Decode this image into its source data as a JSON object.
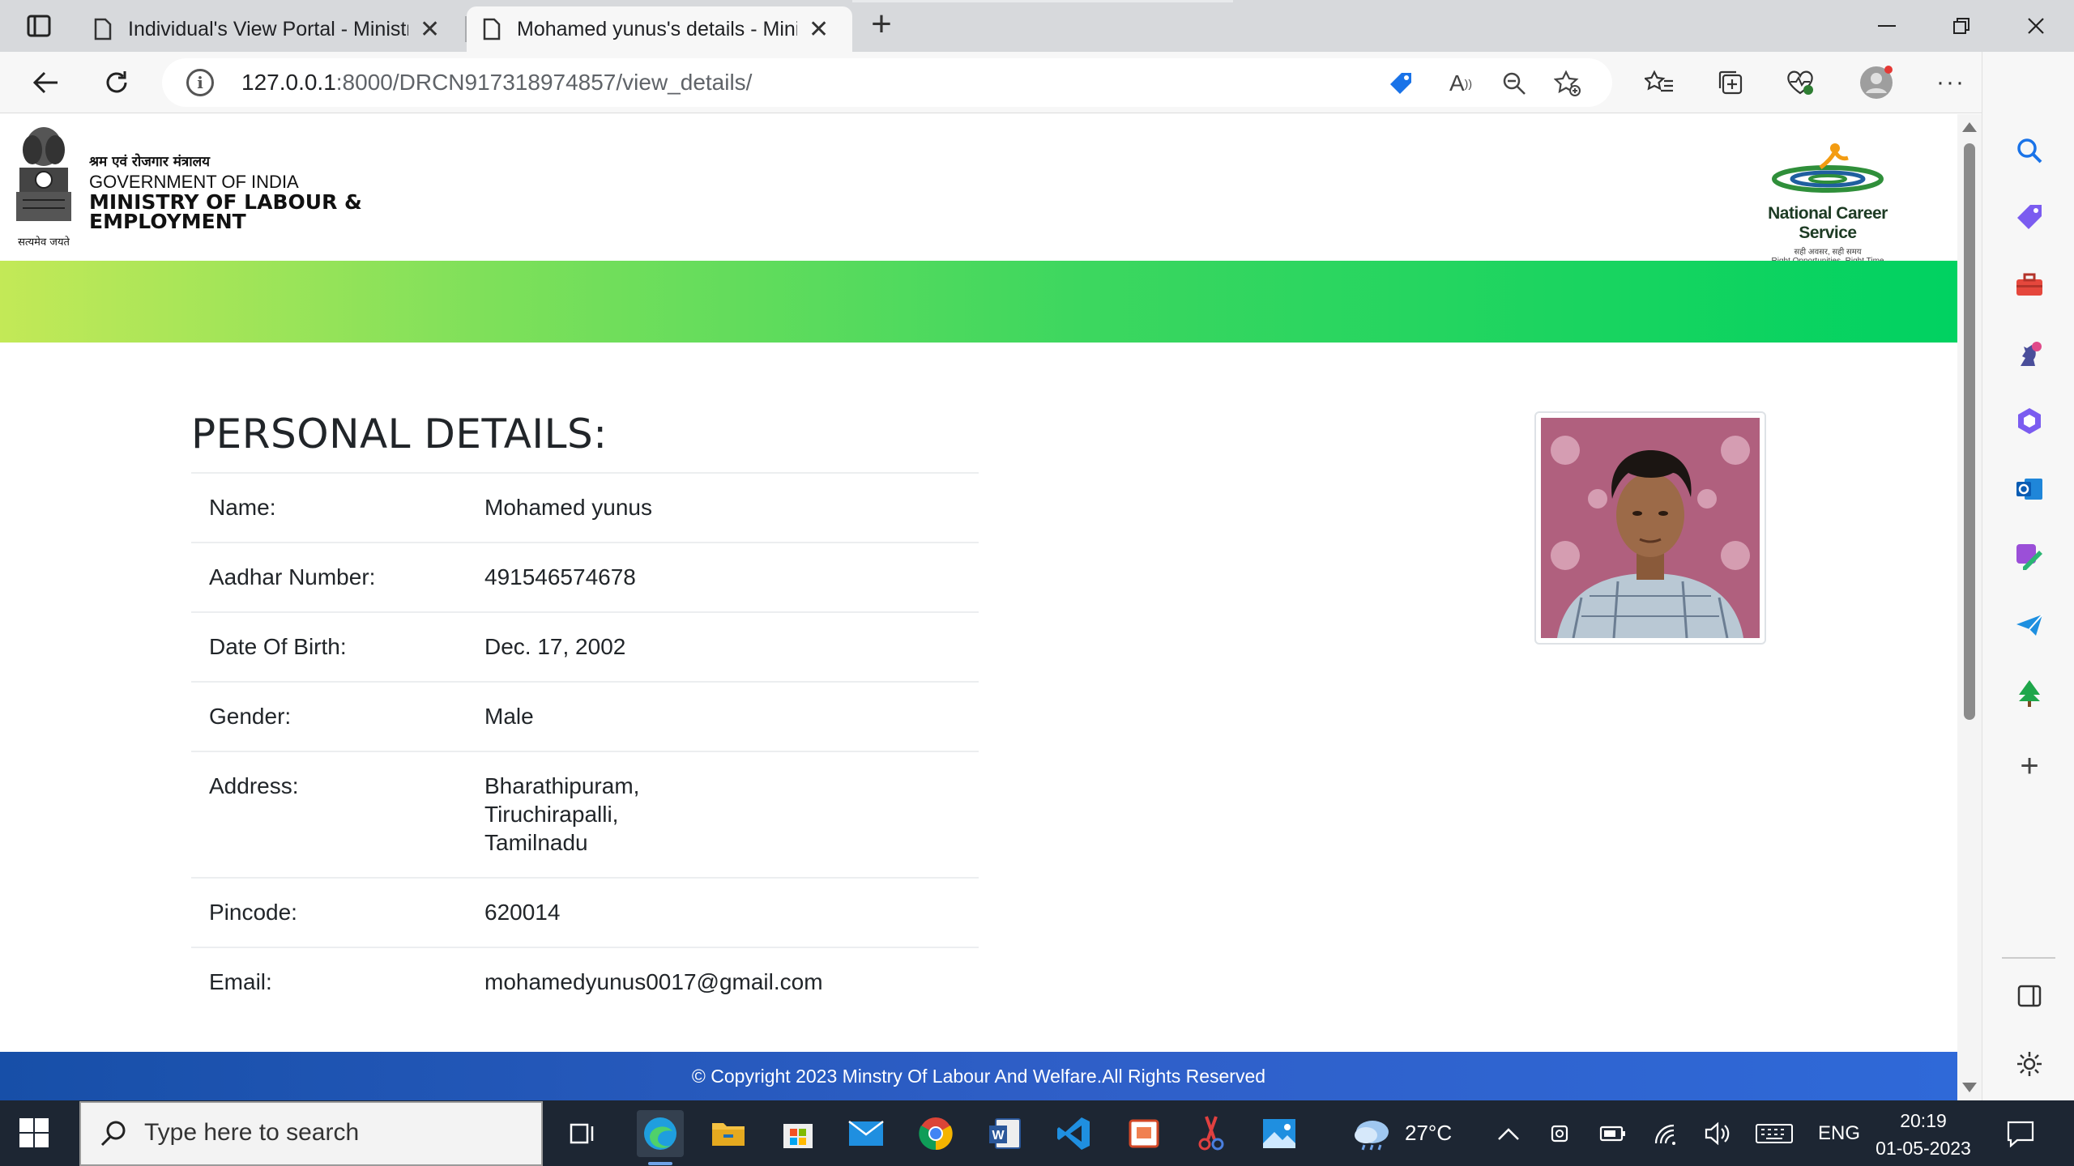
{
  "browser": {
    "tabs": [
      {
        "title": "Individual's View Portal - Ministry of Labour",
        "active": false
      },
      {
        "title": "Mohamed yunus's details - Ministry of Labour",
        "active": true
      }
    ],
    "url_host": "127.0.0.1",
    "url_rest": ":8000/DRCN917318974857/view_details/"
  },
  "header": {
    "emblem_caption": "सत्यमेव जयते",
    "ministry_hindi": "श्रम एवं रोजगार मंत्रालय",
    "government": "GOVERNMENT OF INDIA",
    "ministry_line1": "MINISTRY OF LABOUR &",
    "ministry_line2": "EMPLOYMENT",
    "ncs_title": "National Career Service",
    "ncs_hindi": "सही अवसर, सही समय",
    "ncs_tagline": "Right Opportunities, Right Time"
  },
  "details": {
    "heading": "PERSONAL DETAILS:",
    "rows": [
      {
        "label": "Name:",
        "value": "Mohamed yunus"
      },
      {
        "label": "Aadhar Number:",
        "value": "491546574678"
      },
      {
        "label": "Date Of Birth:",
        "value": "Dec. 17, 2002"
      },
      {
        "label": "Gender:",
        "value": "Male"
      },
      {
        "label": "Address:",
        "value_lines": [
          "Bharathipuram,",
          "Tiruchirapalli,",
          "Tamilnadu"
        ]
      },
      {
        "label": "Pincode:",
        "value": "620014"
      },
      {
        "label": "Email:",
        "value": "mohamedyunus0017@gmail.com"
      }
    ]
  },
  "footer": {
    "text": "© Copyright 2023 Minstry Of Labour And Welfare.All Rights Reserved"
  },
  "taskbar": {
    "search_placeholder": "Type here to search",
    "weather": "27°C",
    "language": "ENG",
    "time": "20:19",
    "date": "01-05-2023"
  },
  "colors": {
    "band_start": "#c3e957",
    "band_end": "#00d261",
    "footer": "#2f5fc8",
    "taskbar": "#1d2633"
  }
}
